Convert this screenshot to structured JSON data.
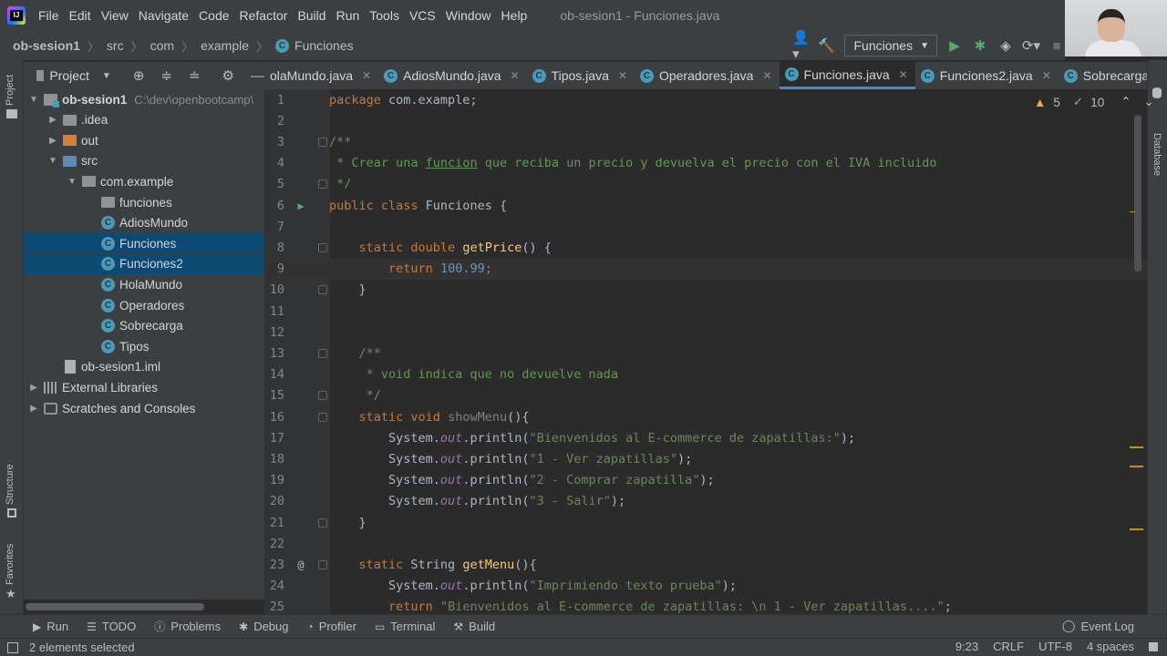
{
  "menubar": {
    "items": [
      "File",
      "Edit",
      "View",
      "Navigate",
      "Code",
      "Refactor",
      "Build",
      "Run",
      "Tools",
      "VCS",
      "Window",
      "Help"
    ],
    "window_title": "ob-sesion1 - Funciones.java"
  },
  "navbar": {
    "crumbs": [
      "ob-sesion1",
      "src",
      "com",
      "example",
      "Funciones"
    ],
    "run_config": "Funciones"
  },
  "project_panel": {
    "title": "Project",
    "stripe_project": "Project",
    "stripe_structure": "Structure",
    "stripe_favorites": "Favorites",
    "stripe_database": "Database",
    "tree": [
      {
        "label": "ob-sesion1",
        "hint": "C:\\dev\\openbootcamp\\",
        "kind": "module",
        "depth": 0,
        "arrow": "down"
      },
      {
        "label": ".idea",
        "kind": "folder",
        "depth": 1,
        "arrow": "right"
      },
      {
        "label": "out",
        "kind": "folder-orange",
        "depth": 1,
        "arrow": "right"
      },
      {
        "label": "src",
        "kind": "folder-blue",
        "depth": 1,
        "arrow": "down"
      },
      {
        "label": "com.example",
        "kind": "folder",
        "depth": 2,
        "arrow": "down"
      },
      {
        "label": "funciones",
        "kind": "folder",
        "depth": 3,
        "arrow": ""
      },
      {
        "label": "AdiosMundo",
        "kind": "class",
        "depth": 3,
        "arrow": ""
      },
      {
        "label": "Funciones",
        "kind": "class",
        "depth": 3,
        "arrow": "",
        "selected": true
      },
      {
        "label": "Funciones2",
        "kind": "class",
        "depth": 3,
        "arrow": "",
        "selected": true
      },
      {
        "label": "HolaMundo",
        "kind": "class",
        "depth": 3,
        "arrow": ""
      },
      {
        "label": "Operadores",
        "kind": "class",
        "depth": 3,
        "arrow": ""
      },
      {
        "label": "Sobrecarga",
        "kind": "class",
        "depth": 3,
        "arrow": ""
      },
      {
        "label": "Tipos",
        "kind": "class",
        "depth": 3,
        "arrow": ""
      },
      {
        "label": "ob-sesion1.iml",
        "kind": "file",
        "depth": 1,
        "arrow": ""
      },
      {
        "label": "External Libraries",
        "kind": "lib",
        "depth": 0,
        "arrow": "right"
      },
      {
        "label": "Scratches and Consoles",
        "kind": "scratch",
        "depth": 0,
        "arrow": "right"
      }
    ]
  },
  "tabs": [
    {
      "label": "olaMundo.java",
      "active": false
    },
    {
      "label": "AdiosMundo.java",
      "active": false
    },
    {
      "label": "Tipos.java",
      "active": false
    },
    {
      "label": "Operadores.java",
      "active": false
    },
    {
      "label": "Funciones.java",
      "active": true
    },
    {
      "label": "Funciones2.java",
      "active": false
    },
    {
      "label": "Sobrecarga.java",
      "active": false
    }
  ],
  "inspection": {
    "warnings": "5",
    "weak_warnings": "10"
  },
  "code": {
    "current_line": 9,
    "lines": [
      {
        "n": "1",
        "tokens": [
          [
            "kw",
            "package "
          ],
          [
            "",
            "com.example;"
          ]
        ]
      },
      {
        "n": "2",
        "tokens": []
      },
      {
        "n": "3",
        "tokens": [
          [
            "cm",
            "/**"
          ]
        ],
        "fold": true
      },
      {
        "n": "4",
        "tokens": [
          [
            "cm",
            " * Crear una "
          ],
          [
            "cm-u",
            "funcion"
          ],
          [
            "cm",
            " que reciba un precio y devuelva el precio con el IVA incluido"
          ]
        ]
      },
      {
        "n": "5",
        "tokens": [
          [
            "cm",
            " */"
          ]
        ],
        "fold": true
      },
      {
        "n": "6",
        "tokens": [
          [
            "kw",
            "public class "
          ],
          [
            "",
            "Funciones {"
          ]
        ],
        "mark": "▶",
        "mark_kind": "run"
      },
      {
        "n": "7",
        "tokens": []
      },
      {
        "n": "8",
        "tokens": [
          [
            "",
            "    "
          ],
          [
            "kw",
            "static double "
          ],
          [
            "fn",
            "getPrice"
          ],
          [
            "",
            "() {"
          ]
        ],
        "fold": true
      },
      {
        "n": "9",
        "tokens": [
          [
            "",
            "        "
          ],
          [
            "kw",
            "return "
          ],
          [
            "num",
            "100.99"
          ],
          [
            "kw",
            ";"
          ]
        ]
      },
      {
        "n": "10",
        "tokens": [
          [
            "",
            "    }"
          ]
        ],
        "fold": true
      },
      {
        "n": "11",
        "tokens": []
      },
      {
        "n": "12",
        "tokens": []
      },
      {
        "n": "13",
        "tokens": [
          [
            "",
            "    "
          ],
          [
            "cm",
            "/**"
          ]
        ],
        "fold": true
      },
      {
        "n": "14",
        "tokens": [
          [
            "cm",
            "     * void indica que no devuelve nada"
          ]
        ]
      },
      {
        "n": "15",
        "tokens": [
          [
            "cm",
            "     */"
          ]
        ],
        "fold": true
      },
      {
        "n": "16",
        "tokens": [
          [
            "",
            "    "
          ],
          [
            "kw",
            "static void "
          ],
          [
            "unused",
            "showMenu"
          ],
          [
            "",
            "(){"
          ]
        ],
        "fold": true
      },
      {
        "n": "17",
        "tokens": [
          [
            "",
            "        System."
          ],
          [
            "fld",
            "out"
          ],
          [
            "",
            ".println("
          ],
          [
            "str",
            "\"Bienvenidos al E-commerce de zapatillas:\""
          ],
          [
            "",
            "); "
          ]
        ]
      },
      {
        "n": "18",
        "tokens": [
          [
            "",
            "        System."
          ],
          [
            "fld",
            "out"
          ],
          [
            "",
            ".println("
          ],
          [
            "str",
            "\"1 - Ver zapatillas\""
          ],
          [
            "",
            "); "
          ]
        ]
      },
      {
        "n": "19",
        "tokens": [
          [
            "",
            "        System."
          ],
          [
            "fld",
            "out"
          ],
          [
            "",
            ".println("
          ],
          [
            "str",
            "\"2 - Comprar zapatilla\""
          ],
          [
            "",
            "); "
          ]
        ]
      },
      {
        "n": "20",
        "tokens": [
          [
            "",
            "        System."
          ],
          [
            "fld",
            "out"
          ],
          [
            "",
            ".println("
          ],
          [
            "str",
            "\"3 - Salir\""
          ],
          [
            "",
            "); "
          ]
        ]
      },
      {
        "n": "21",
        "tokens": [
          [
            "",
            "    }"
          ]
        ],
        "fold": true
      },
      {
        "n": "22",
        "tokens": []
      },
      {
        "n": "23",
        "tokens": [
          [
            "",
            "    "
          ],
          [
            "kw",
            "static "
          ],
          [
            "",
            "String "
          ],
          [
            "fn",
            "getMenu"
          ],
          [
            "",
            "(){"
          ]
        ],
        "fold": true,
        "mark": "@",
        "mark_kind": "at"
      },
      {
        "n": "24",
        "tokens": [
          [
            "",
            "        System."
          ],
          [
            "fld",
            "out"
          ],
          [
            "",
            ".println("
          ],
          [
            "str",
            "\"Imprimiendo texto prueba\""
          ],
          [
            "",
            "); "
          ]
        ]
      },
      {
        "n": "25",
        "tokens": [
          [
            "",
            "        "
          ],
          [
            "kw",
            "return "
          ],
          [
            "str",
            "\"Bienvenidos al E-commerce de zapatillas: \\n 1 - Ver zapatillas....\""
          ],
          [
            "",
            ";"
          ]
        ]
      }
    ]
  },
  "bottom_tools": [
    {
      "label": "Run",
      "icon": "play-icon"
    },
    {
      "label": "TODO",
      "icon": "list-icon"
    },
    {
      "label": "Problems",
      "icon": "info-icon"
    },
    {
      "label": "Debug",
      "icon": "bug-icon"
    },
    {
      "label": "Profiler",
      "icon": "profiler-icon"
    },
    {
      "label": "Terminal",
      "icon": "terminal-icon"
    },
    {
      "label": "Build",
      "icon": "hammer-icon"
    }
  ],
  "event_log": "Event Log",
  "status": {
    "message": "2 elements selected",
    "position": "9:23",
    "line_sep": "CRLF",
    "encoding": "UTF-8",
    "indent": "4 spaces"
  }
}
